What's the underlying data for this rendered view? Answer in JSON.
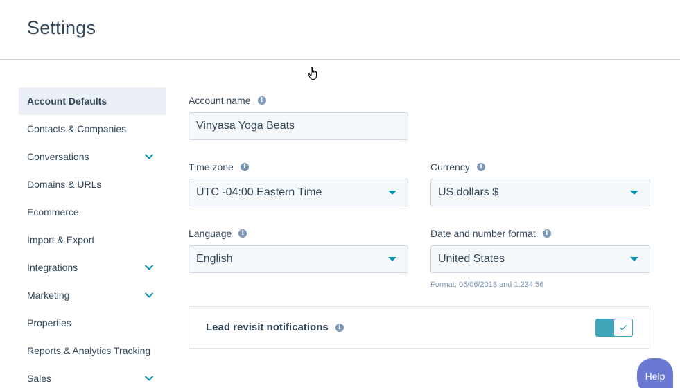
{
  "header": {
    "title": "Settings"
  },
  "sidebar": {
    "items": [
      {
        "label": "Account Defaults",
        "active": true,
        "has_chevron": false
      },
      {
        "label": "Contacts & Companies",
        "has_chevron": false
      },
      {
        "label": "Conversations",
        "has_chevron": true
      },
      {
        "label": "Domains & URLs",
        "has_chevron": false
      },
      {
        "label": "Ecommerce",
        "has_chevron": false
      },
      {
        "label": "Import & Export",
        "has_chevron": false
      },
      {
        "label": "Integrations",
        "has_chevron": true
      },
      {
        "label": "Marketing",
        "has_chevron": true
      },
      {
        "label": "Properties",
        "has_chevron": false
      },
      {
        "label": "Reports & Analytics Tracking",
        "has_chevron": false
      },
      {
        "label": "Sales",
        "has_chevron": true
      }
    ]
  },
  "form": {
    "account_name": {
      "label": "Account name",
      "value": "Vinyasa Yoga Beats"
    },
    "time_zone": {
      "label": "Time zone",
      "value": "UTC -04:00 Eastern Time"
    },
    "currency": {
      "label": "Currency",
      "value": "US dollars $"
    },
    "language": {
      "label": "Language",
      "value": "English"
    },
    "date_format": {
      "label": "Date and number format",
      "value": "United States",
      "hint": "Format: 05/06/2018 and 1,234.56"
    }
  },
  "lead_revisit": {
    "label": "Lead revisit notifications",
    "enabled": true
  },
  "help": {
    "label": "Help"
  },
  "icons": {
    "info": "info-icon",
    "chevron": "chevron-down-icon",
    "caret": "dropdown-caret-icon",
    "check": "check-icon",
    "cursor": "pointer-cursor-icon"
  },
  "colors": {
    "accent": "#0091ae",
    "toggle_on": "#3ea6b8",
    "help": "#6a78d1",
    "sidebar_active": "#eaf0f6",
    "text": "#33475b",
    "muted": "#7c98b6"
  }
}
